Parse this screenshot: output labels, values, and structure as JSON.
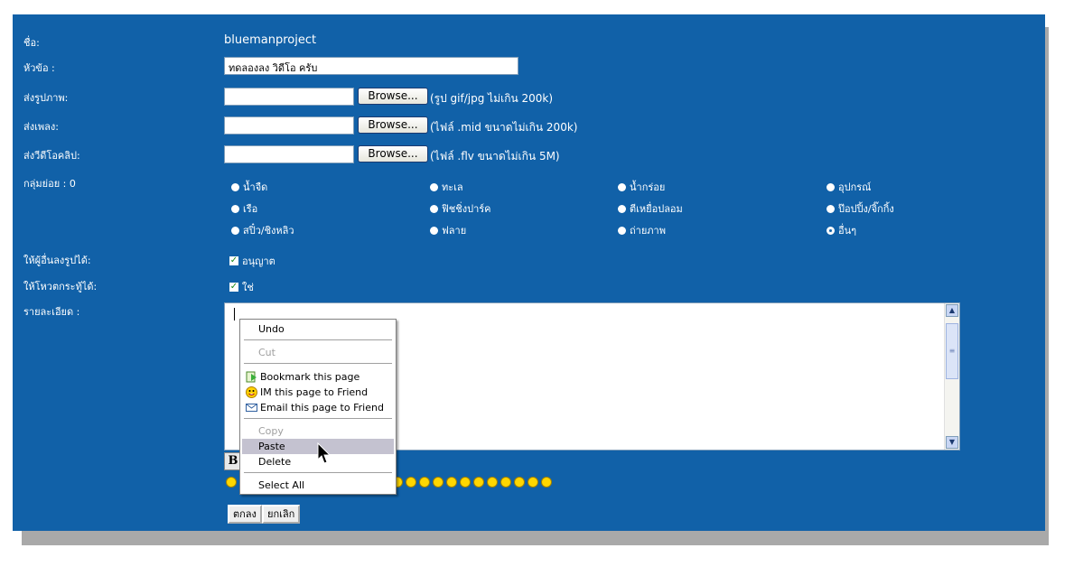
{
  "form": {
    "name_label": "ชื่อ:",
    "name_value": "bluemanproject",
    "subject_label": "หัวข้อ :",
    "subject_value": "ทดลองลง วิดีโอ ครับ",
    "image_label": "ส่งรูปภาพ:",
    "image_hint": "(รูป gif/jpg ไม่เกิน 200k)",
    "music_label": "ส่งเพลง:",
    "music_hint": "(ไฟล์ .mid ขนาดไม่เกิน 200k)",
    "video_label": "ส่งวีดีโอคลิป:",
    "video_hint": "(ไฟล์ .flv ขนาดไม่เกิน 5M)",
    "browse_label": "Browse...",
    "group_label": "กลุ่มย่อย : 0",
    "groups": [
      "น้ำจืด",
      "ทะเล",
      "น้ำกร่อย",
      "อุปกรณ์",
      "เรือ",
      "ฟิชชิ่งปาร์ค",
      "ตีเหยื่อปลอม",
      "ป๊อปปิ้ง/จิ๊กกิ้ง",
      "สปิ๋ว/ชิงหลิว",
      "ฟลาย",
      "ถ่ายภาพ",
      "อื่นๆ"
    ],
    "selected_group": "อื่นๆ",
    "allow_images_label": "ให้ผู้อื่นลงรูปได้:",
    "allow_images_value": "อนุญาต",
    "allow_vote_label": "ให้โหวตกระทู้ได้:",
    "allow_vote_value": "ใช่",
    "detail_label": "รายละเอียด :",
    "bold_label": "B",
    "submit_label": "ตกลง",
    "cancel_label": "ยกเลิก"
  },
  "context_menu": {
    "undo": "Undo",
    "cut": "Cut",
    "bookmark": "Bookmark this page",
    "im": "IM this page to Friend",
    "email": "Email this page to Friend",
    "copy": "Copy",
    "paste": "Paste",
    "delete": "Delete",
    "select_all": "Select All"
  },
  "colors": {
    "panel": "#1161a8",
    "shadow": "#a9a9a9",
    "menu_highlight": "#c4c2d0"
  }
}
